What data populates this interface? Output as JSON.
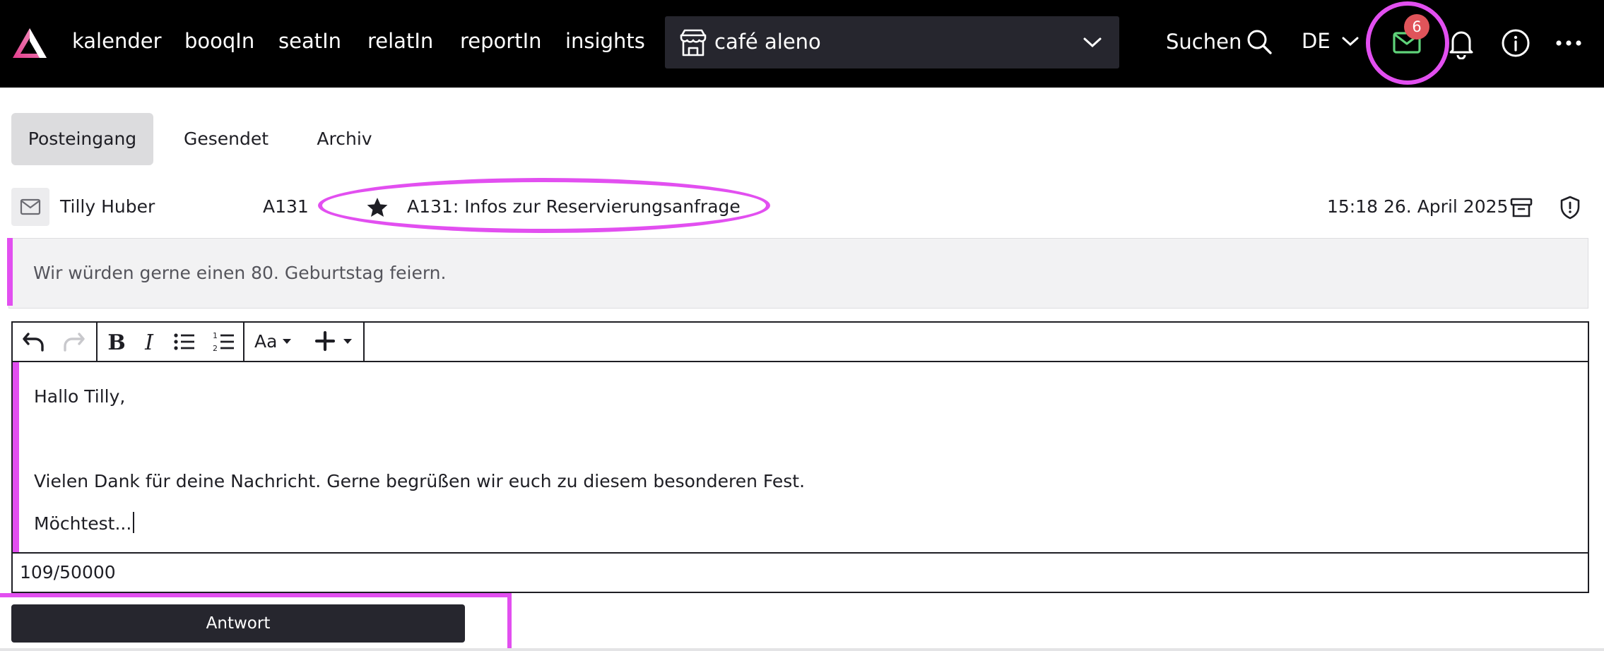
{
  "nav": {
    "items": [
      {
        "label": "kalender"
      },
      {
        "label": "booqIn"
      },
      {
        "label": "seatIn"
      },
      {
        "label": "relatIn"
      },
      {
        "label": "reportIn"
      },
      {
        "label": "insights"
      }
    ],
    "venue": "café aleno",
    "search_label": "Suchen",
    "language": "DE",
    "unread_count": "6"
  },
  "tabs": [
    {
      "label": "Posteingang",
      "active": true
    },
    {
      "label": "Gesendet",
      "active": false
    },
    {
      "label": "Archiv",
      "active": false
    }
  ],
  "message": {
    "sender": "Tilly Huber",
    "code": "A131",
    "subject": "A131: Infos zur Reservierungsanfrage",
    "timestamp": "15:18 26. April 2025",
    "quote": "Wir würden gerne einen 80. Geburtstag feiern."
  },
  "editor": {
    "toolbar": {
      "font_size_label": "Aa"
    },
    "lines": [
      "Hallo Tilly,",
      "Vielen Dank für deine Nachricht. Gerne begrüßen wir euch zu diesem besonderen Fest.",
      "Möchtest..."
    ],
    "counter": "109/50000"
  },
  "reply_button": "Antwort",
  "colors": {
    "topbar": "#000000",
    "accent_pink": "#e24ff0",
    "mail_green": "#5fd37a",
    "badge_red": "#e0545a",
    "dark_button": "#26262e"
  }
}
